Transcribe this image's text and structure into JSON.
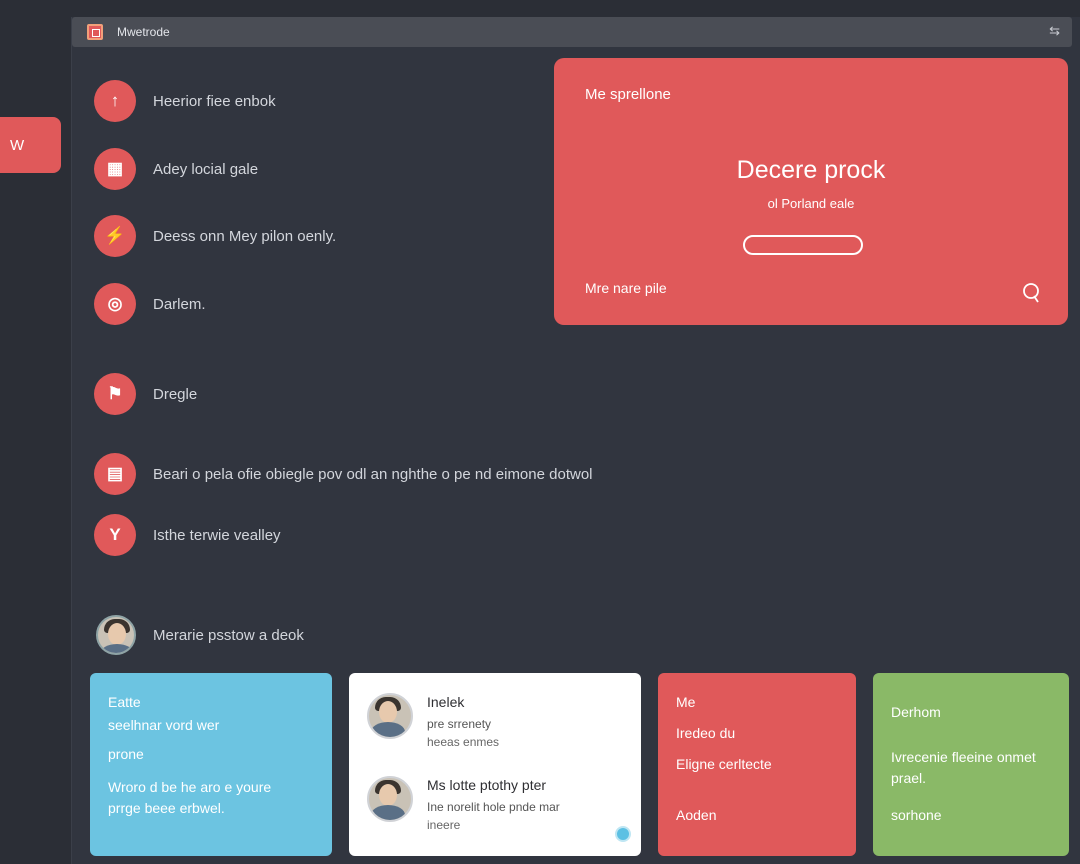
{
  "side_tab": {
    "label": "W"
  },
  "window": {
    "title": "Mwetrode"
  },
  "features": [
    {
      "icon": "pin-icon",
      "glyph": "↑",
      "label": "Heerior fiee enbok"
    },
    {
      "icon": "grid-icon",
      "glyph": "▦",
      "label": "Adey locial gale"
    },
    {
      "icon": "lightning-icon",
      "glyph": "⚡",
      "label": "Deess onn Mey pilon oenly."
    },
    {
      "icon": "target-icon",
      "glyph": "◎",
      "label": "Darlem."
    },
    {
      "icon": "flag-icon",
      "glyph": "⚑",
      "label": "Dregle"
    },
    {
      "icon": "document-icon",
      "glyph": "▤",
      "label": "Beari o pela ofie obiegle pov odl an nghthe o pe nd eimone dotwol"
    },
    {
      "icon": "cocktail-icon",
      "glyph": "Y",
      "label": "Isthe terwie vealley"
    }
  ],
  "profile": {
    "label": "Merarie psstow a deok"
  },
  "hero": {
    "top_label": "Me sprellone",
    "title": "Decere prock",
    "subtitle": "ol Porland eale",
    "input_value": "",
    "bottom_label": "Mre nare pile",
    "accent": "#e0595a"
  },
  "cards": {
    "blue": {
      "line1": "Eatte",
      "line2": "seelhnar vord wer",
      "line3": "prone",
      "line4": "Wroro d be he aro e youre",
      "line5": "prrge beee erbwel."
    },
    "white": {
      "people": [
        {
          "name": "Inelek",
          "sub": "pre srrenety",
          "sub2": "heeas enmes"
        },
        {
          "name": "Ms lotte ptothy pter",
          "sub": "Ine norelit hole pnde mar",
          "sub2": "ineere"
        }
      ]
    },
    "red": {
      "line1": "Me",
      "line2": "Iredeo du",
      "line3": "Eligne cerltecte",
      "line4": "Aoden"
    },
    "green": {
      "line1": "Derhom",
      "line2": "Ivrecenie fleeine onmet",
      "line3": "prael.",
      "line4": "sorhone"
    }
  },
  "colors": {
    "accent": "#e0595a",
    "blue": "#6cc4e1",
    "green": "#8ab967",
    "background": "#2b2e36"
  }
}
